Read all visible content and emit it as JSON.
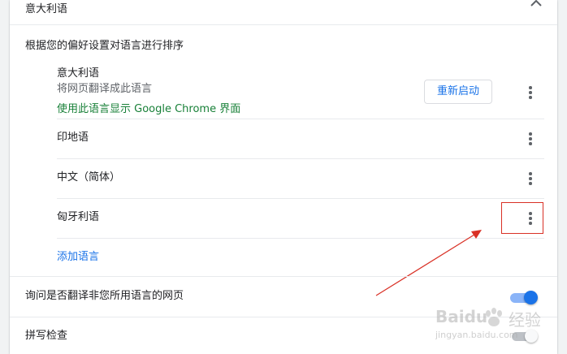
{
  "header": {
    "title": "意大利语",
    "collapse_icon": "chevron-up-icon"
  },
  "order_section": {
    "label": "根据您的偏好设置对语言进行排序"
  },
  "languages": [
    {
      "name": "意大利语",
      "subtitle": "将网页翻译成此语言",
      "ui_note": "使用此语言显示 Google Chrome 界面",
      "restart_label": "重新启动",
      "menu_icon": "more-vert-icon"
    },
    {
      "name": "印地语",
      "menu_icon": "more-vert-icon"
    },
    {
      "name": "中文（简体）",
      "menu_icon": "more-vert-icon"
    },
    {
      "name": "匈牙利语",
      "menu_icon": "more-vert-icon"
    }
  ],
  "add_language_label": "添加语言",
  "translate_offer": {
    "label": "询问是否翻译非您所用语言的网页",
    "enabled": true
  },
  "spellcheck": {
    "label": "拼写检查",
    "enabled": false
  },
  "watermark": {
    "brand": "Baidu",
    "product": "经验",
    "url": "jingyan.baidu.com"
  },
  "colors": {
    "accent": "#1a73e8",
    "toggle_track_on": "#8ab4f8",
    "green_note": "#188038",
    "annotation_red": "#d93025"
  }
}
